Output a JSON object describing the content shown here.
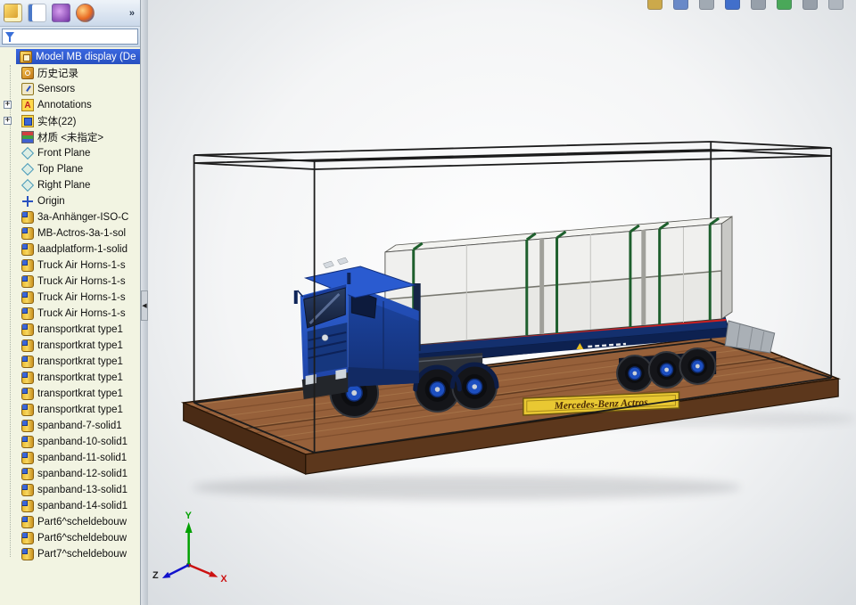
{
  "colors": {
    "selection_blue": "#2f5bd7",
    "truck_blue": "#1e4fc2",
    "base_wood": "#8a5432",
    "nameplate_yellow": "#e8c832",
    "strap_green": "#1e5f2d"
  },
  "panel_toolbar": {
    "overflow_chevron": "»",
    "icons": [
      {
        "name": "featuremanager-icon"
      },
      {
        "name": "display-pane-icon"
      },
      {
        "name": "propertymanager-icon"
      },
      {
        "name": "appearances-icon"
      }
    ]
  },
  "filter": {
    "value": ""
  },
  "tree": {
    "root": {
      "label": "Model MB display  (De",
      "icon": "assembly"
    },
    "items": [
      {
        "label": "历史记录",
        "icon": "history"
      },
      {
        "label": "Sensors",
        "icon": "sensors"
      },
      {
        "label": "Annotations",
        "icon": "annotations",
        "expandable": true
      },
      {
        "label": "实体(22)",
        "icon": "solids",
        "expandable": true
      },
      {
        "label": "材质 <未指定>",
        "icon": "material"
      },
      {
        "label": "Front Plane",
        "icon": "plane"
      },
      {
        "label": "Top Plane",
        "icon": "plane"
      },
      {
        "label": "Right Plane",
        "icon": "plane"
      },
      {
        "label": "Origin",
        "icon": "origin"
      },
      {
        "label": "3a-Anhänger-ISO-C",
        "icon": "body"
      },
      {
        "label": "MB-Actros-3a-1-sol",
        "icon": "body"
      },
      {
        "label": "laadplatform-1-solid",
        "icon": "body"
      },
      {
        "label": "Truck Air Horns-1-s",
        "icon": "body"
      },
      {
        "label": "Truck Air Horns-1-s",
        "icon": "body"
      },
      {
        "label": "Truck Air Horns-1-s",
        "icon": "body"
      },
      {
        "label": "Truck Air Horns-1-s",
        "icon": "body"
      },
      {
        "label": "transportkrat type1",
        "icon": "body"
      },
      {
        "label": "transportkrat type1",
        "icon": "body"
      },
      {
        "label": "transportkrat type1",
        "icon": "body"
      },
      {
        "label": "transportkrat type1",
        "icon": "body"
      },
      {
        "label": "transportkrat type1",
        "icon": "body"
      },
      {
        "label": "transportkrat type1",
        "icon": "body"
      },
      {
        "label": "spanband-7-solid1",
        "icon": "body"
      },
      {
        "label": "spanband-10-solid1",
        "icon": "body"
      },
      {
        "label": "spanband-11-solid1",
        "icon": "body"
      },
      {
        "label": "spanband-12-solid1",
        "icon": "body"
      },
      {
        "label": "spanband-13-solid1",
        "icon": "body"
      },
      {
        "label": "spanband-14-solid1",
        "icon": "body"
      },
      {
        "label": "Part6^scheldebouw",
        "icon": "body"
      },
      {
        "label": "Part6^scheldebouw",
        "icon": "body"
      },
      {
        "label": "Part7^scheldebouw",
        "icon": "body"
      }
    ]
  },
  "viewport": {
    "top_icons": [
      {
        "name": "view-cube-icon",
        "color": "#c9a23a"
      },
      {
        "name": "display-style-icon",
        "color": "#5b7fc4"
      },
      {
        "name": "section-view-icon",
        "color": "#9aa3ad"
      },
      {
        "name": "edit-appearance-icon",
        "color": "#2f62c8"
      },
      {
        "name": "scene-settings-icon",
        "color": "#8f98a3"
      },
      {
        "name": "render-icon",
        "color": "#3aa24a"
      },
      {
        "name": "options-icon",
        "color": "#8f98a3"
      },
      {
        "name": "help-icon",
        "color": "#aab2ba"
      }
    ],
    "nameplate_text": "Mercedes-Benz Actros"
  },
  "triad": {
    "x_label": "X",
    "y_label": "Y",
    "z_label": "Z"
  }
}
